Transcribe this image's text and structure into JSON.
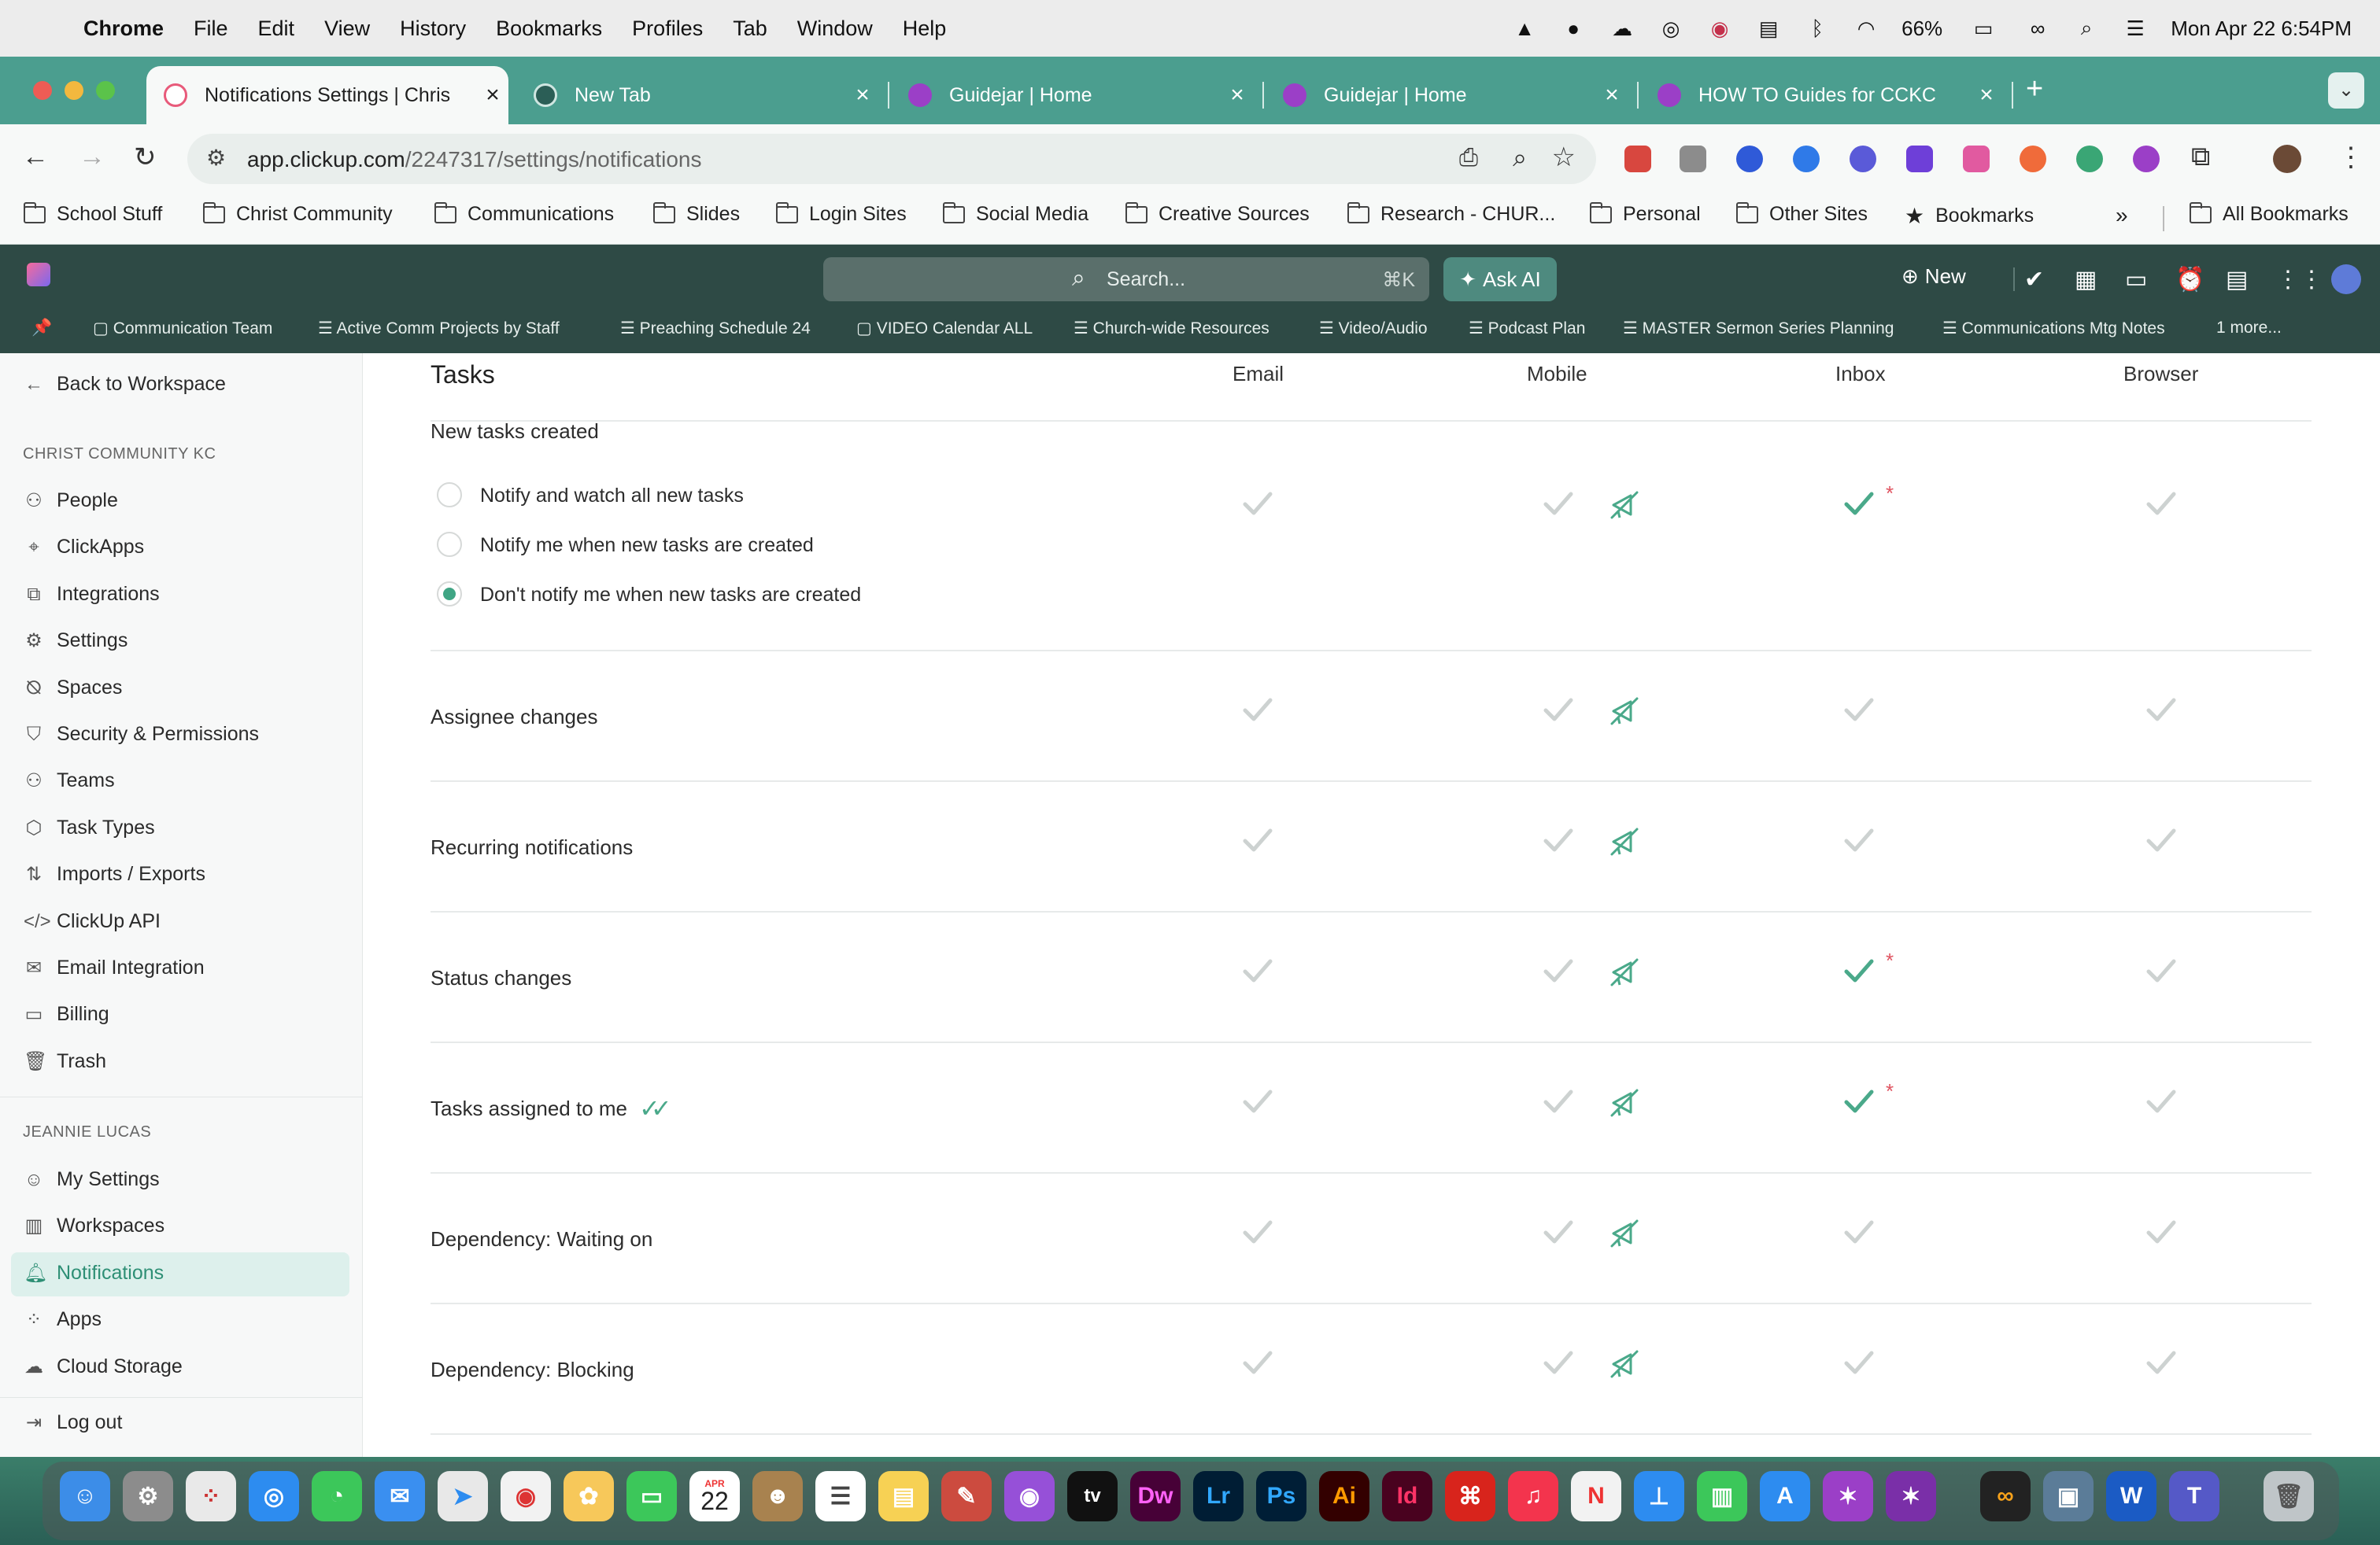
{
  "menubar": {
    "app": "Chrome",
    "menus": [
      "File",
      "Edit",
      "View",
      "History",
      "Bookmarks",
      "Profiles",
      "Tab",
      "Window",
      "Help"
    ],
    "battery": "66%",
    "clock": "Mon Apr 22  6:54PM"
  },
  "tabs": [
    {
      "title": "Notifications Settings | Chris",
      "active": true
    },
    {
      "title": "New Tab"
    },
    {
      "title": "Guidejar | Home"
    },
    {
      "title": "Guidejar | Home"
    },
    {
      "title": "HOW TO Guides for CCKC"
    }
  ],
  "address": {
    "host": "app.clickup.com",
    "path": "/2247317/settings/notifications"
  },
  "bookmarks": [
    "School Stuff",
    "Christ Community",
    "Communications",
    "Slides",
    "Login Sites",
    "Social Media",
    "Creative Sources",
    "Research - CHUR...",
    "Personal",
    "Other Sites",
    "Bookmarks",
    "All Bookmarks"
  ],
  "header": {
    "search_placeholder": "Search...",
    "search_shortcut": "⌘K",
    "ask_ai": "Ask AI",
    "new_label": "New"
  },
  "favorites": [
    "Communication Team",
    "Active Comm Projects by Staff",
    "Preaching Schedule 24",
    "VIDEO Calendar ALL",
    "Church-wide Resources",
    "Video/Audio",
    "Podcast Plan",
    "MASTER Sermon Series Planning",
    "Communications Mtg Notes",
    "1 more..."
  ],
  "sidebar": {
    "back": "Back to Workspace",
    "workspace_header": "CHRIST COMMUNITY KC",
    "workspace_items": [
      "People",
      "ClickApps",
      "Integrations",
      "Settings",
      "Spaces",
      "Security & Permissions",
      "Teams",
      "Task Types",
      "Imports / Exports",
      "ClickUp API",
      "Email Integration",
      "Billing",
      "Trash"
    ],
    "user_header": "JEANNIE LUCAS",
    "user_items": [
      "My Settings",
      "Workspaces",
      "Notifications",
      "Apps",
      "Cloud Storage"
    ],
    "logout": "Log out"
  },
  "main": {
    "section_title": "Tasks",
    "columns": [
      "Email",
      "Mobile",
      "Inbox",
      "Browser"
    ],
    "new_tasks_label": "New tasks created",
    "new_tasks_options": [
      "Notify and watch all new tasks",
      "Notify me when new tasks are created",
      "Don't notify me when new tasks are created"
    ],
    "selected_option_index": 2,
    "rows": [
      "Assignee changes",
      "Recurring notifications",
      "Status changes",
      "Tasks assigned to me",
      "Dependency: Waiting on",
      "Dependency: Blocking"
    ]
  },
  "dock": {
    "calendar_month": "APR",
    "calendar_day": "22"
  },
  "colors": {
    "accent": "#3fa584",
    "header": "#2e4a45",
    "tabbar": "#4b9e8f",
    "check_off": "#cdd2d1",
    "check_on": "#4aa98a"
  }
}
